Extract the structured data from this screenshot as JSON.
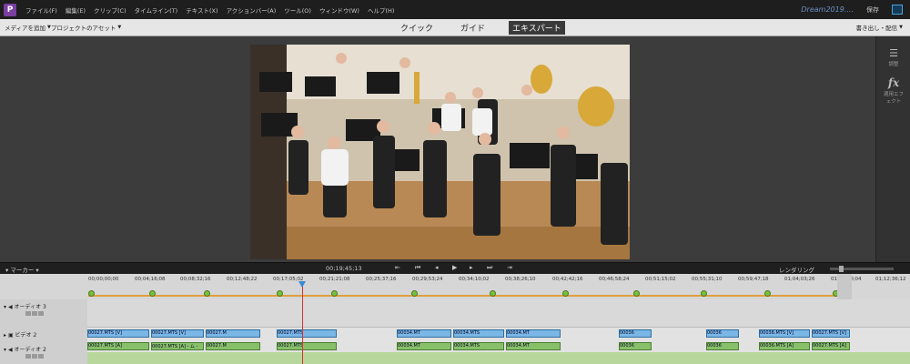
{
  "menu": {
    "logo": "P",
    "items": [
      "ファイル(F)",
      "編集(E)",
      "クリップ(C)",
      "タイムライン(T)",
      "テキスト(X)",
      "アクションバー(A)",
      "ツール(O)",
      "ウィンドウ(W)",
      "ヘルプ(H)"
    ],
    "project_name": "Dream2019....",
    "save": "保存"
  },
  "modebar": {
    "add_media": "メディアを追加",
    "project_assets": "プロジェクトのアセット",
    "tabs": [
      "クイック",
      "ガイド",
      "エキスパート"
    ],
    "active_tab": "エキスパート",
    "export": "書き出し・配信"
  },
  "right_panel": {
    "adjust": "調整",
    "fx": "fx",
    "applied_effects": "適用エフェクト"
  },
  "timeline": {
    "marker": "マーカー",
    "current_time": "00;19;45;13",
    "render": "レンダリング",
    "ruler_labels": [
      "00;00;00;00",
      "00;04;16;08",
      "00;08;32;16",
      "00;12;48;22",
      "00;17;05;02",
      "00;21;21;08",
      "00;25;37;16",
      "00;29;53;24",
      "00;34;10;02",
      "00;38;26;10",
      "00;42;42;16",
      "00;46;58;24",
      "00;51;15;02",
      "00;55;31;10",
      "00;59;47;18",
      "01;04;03;26",
      "01;08;20;04",
      "01;12;36;12"
    ],
    "tracks": {
      "audio3": "オーディオ 3",
      "video2": "ビデオ 2",
      "audio2": "オーディオ 2"
    },
    "video_clips": [
      "00027.MTS [V]",
      "00027.MTS [V]",
      "00027.M",
      "00027.MTS",
      "00034.MT",
      "00034.MTS",
      "00034.MT",
      "00036",
      "00036",
      "00036.MTS [V]",
      "00027.MTS [V]"
    ],
    "audio_clips": [
      "00027.MTS [A]",
      "00027.MTS [A] - ム -",
      "00027.M",
      "00027.MTS",
      "00034.MT",
      "00034.MTS",
      "00034.MT",
      "00036",
      "00036",
      "00036.MTS [A]",
      "00027.MTS [A]"
    ]
  }
}
